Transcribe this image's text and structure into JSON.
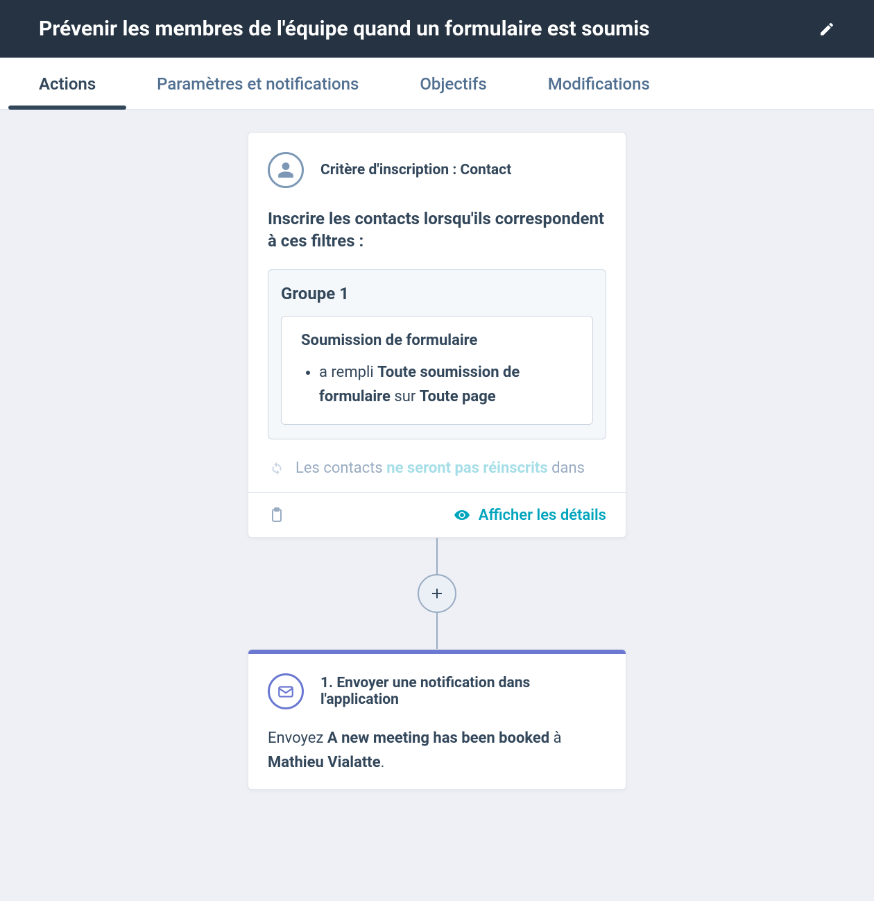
{
  "header": {
    "title": "Prévenir les membres de l'équipe quand un formulaire est soumis"
  },
  "tabs": [
    {
      "label": "Actions",
      "active": true
    },
    {
      "label": "Paramètres et notifications",
      "active": false
    },
    {
      "label": "Objectifs",
      "active": false
    },
    {
      "label": "Modifications",
      "active": false
    }
  ],
  "enrollment_card": {
    "head_label": "Critère d'inscription : Contact",
    "subtitle": "Inscrire les contacts lorsqu'ils correspondent à ces filtres :",
    "group_title": "Groupe 1",
    "filter_title": "Soumission de formulaire",
    "filter_prefix": "a rempli ",
    "filter_bold1": "Toute soumission de formulaire",
    "filter_mid": " sur ",
    "filter_bold2": "Toute page",
    "fade_prefix": "Les contacts ",
    "fade_link": "ne seront pas réinscrits",
    "fade_suffix": " dans",
    "footer_link": "Afficher les détails"
  },
  "notification_card": {
    "head_label": "1. Envoyer une notification dans l'application",
    "desc_prefix": "Envoyez ",
    "desc_bold1": "A new meeting has been booked",
    "desc_mid": " à ",
    "desc_bold2": "Mathieu Vialatte",
    "desc_suffix": "."
  }
}
